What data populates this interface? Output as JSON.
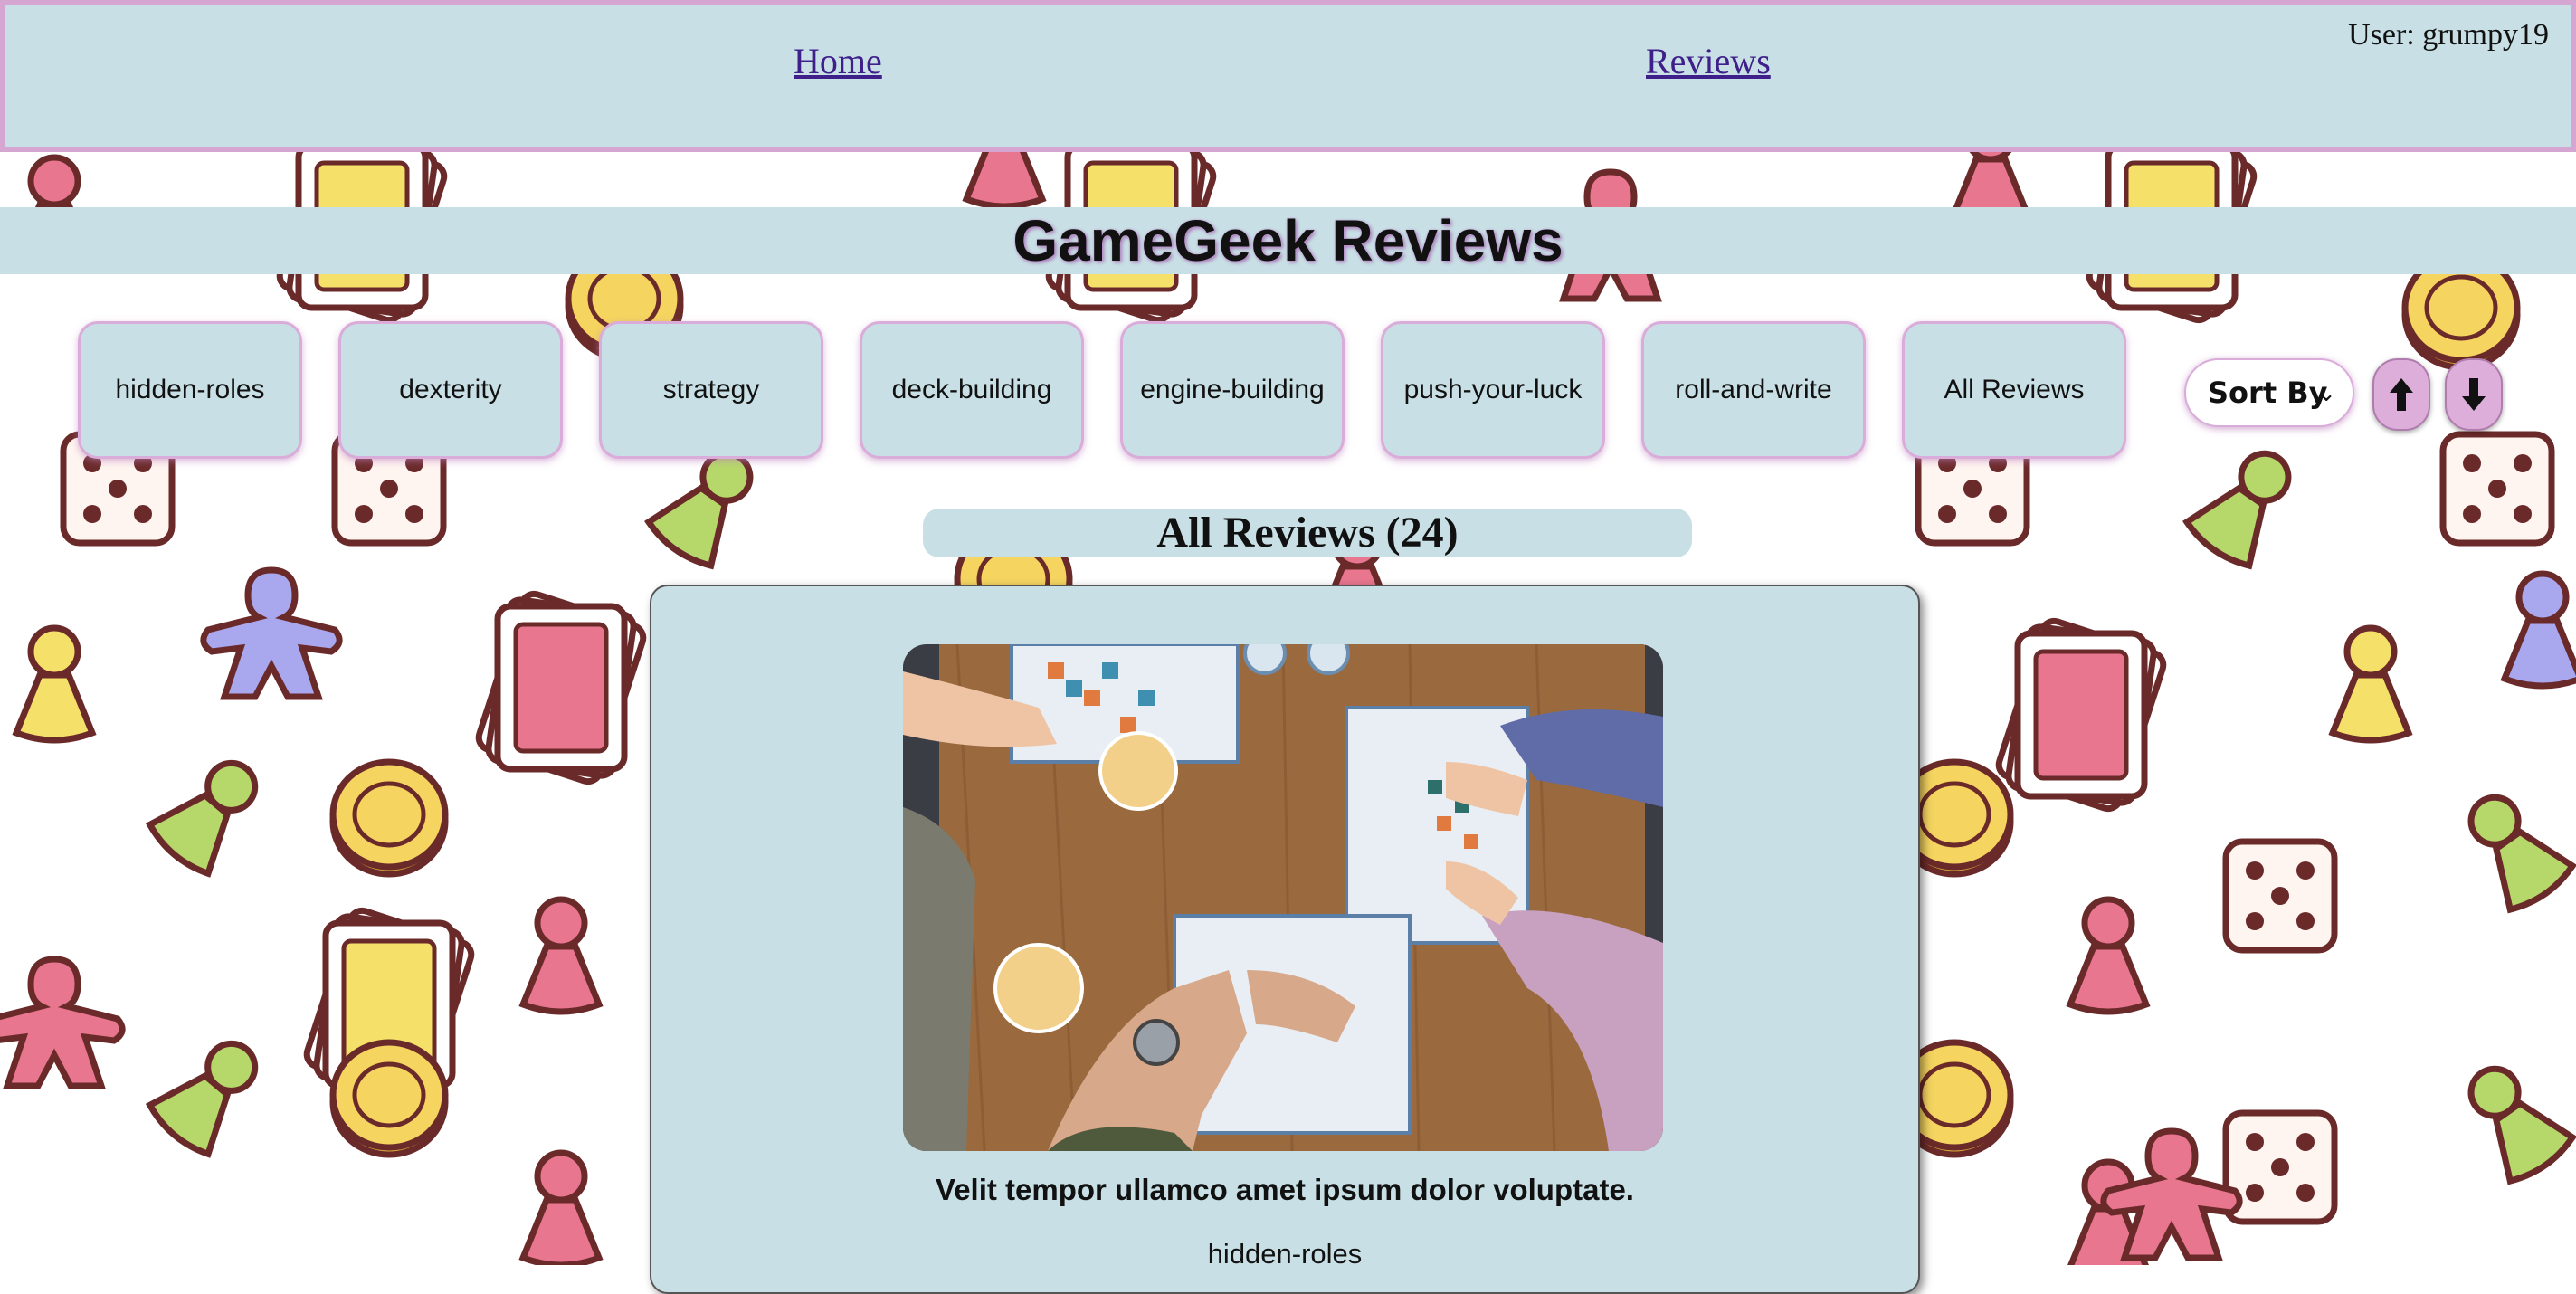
{
  "nav": {
    "home_label": "Home",
    "reviews_label": "Reviews",
    "user_text": "User: grumpy19"
  },
  "header": {
    "title": "GameGeek Reviews"
  },
  "categories": [
    {
      "label": "hidden-roles"
    },
    {
      "label": "dexterity"
    },
    {
      "label": "strategy"
    },
    {
      "label": "deck-building"
    },
    {
      "label": "engine-building"
    },
    {
      "label": "push-your-luck"
    },
    {
      "label": "roll-and-write"
    },
    {
      "label": "All Reviews"
    }
  ],
  "sort": {
    "label": "Sort By",
    "asc_icon": "arrow-up-icon",
    "desc_icon": "arrow-down-icon"
  },
  "listing": {
    "heading": "All Reviews (24)"
  },
  "reviews": [
    {
      "title": "Velit tempor ullamco amet ipsum dolor voluptate.",
      "category": "hidden-roles",
      "image": "board-game-table-photo"
    }
  ],
  "colors": {
    "panel": "#c8e0e5",
    "accent": "#d6a6d2",
    "link": "#3f1f8a",
    "pink": "#e8768f",
    "yellow": "#f5e06a",
    "green": "#b6d86a",
    "lavender": "#a9a8ef",
    "outline": "#6b2a2a"
  }
}
